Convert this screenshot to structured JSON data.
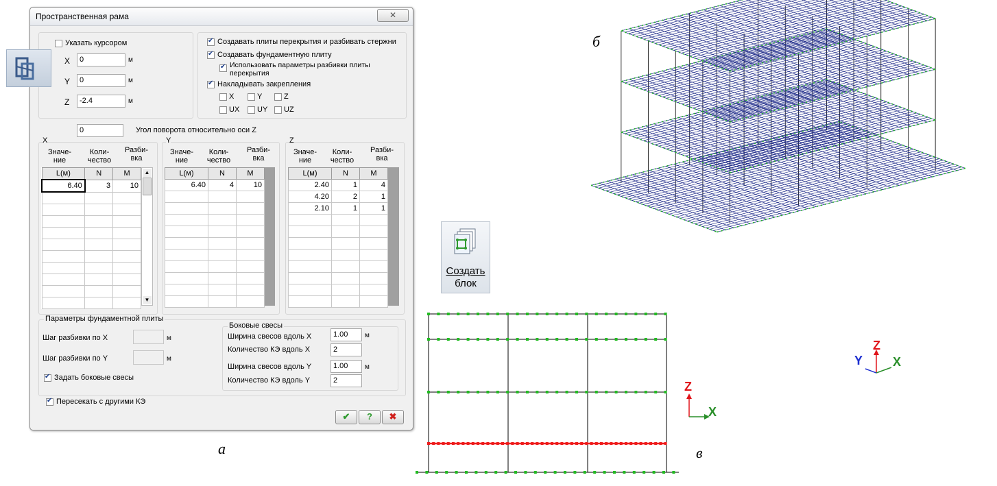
{
  "dialog": {
    "title": "Пространственная рама",
    "close_icon": "close-icon",
    "cursor": {
      "label": "Указать курсором",
      "checked": false
    },
    "coords": [
      {
        "axis": "X",
        "value": "0",
        "unit": "м"
      },
      {
        "axis": "Y",
        "value": "0",
        "unit": "м"
      },
      {
        "axis": "Z",
        "value": "-2.4",
        "unit": "м"
      }
    ],
    "options": {
      "create_slabs": {
        "label": "Создавать плиты перекрытия и разбивать стержни",
        "checked": true
      },
      "create_foundation": {
        "label": "Создавать фундаментную плиту",
        "checked": true
      },
      "use_params": {
        "label": "Использовать параметры разбивки плиты",
        "label2": "перекрытия",
        "checked": true
      },
      "restraints": {
        "label": "Накладывать закрепления",
        "checked": true
      },
      "dofs": [
        {
          "label": "X",
          "checked": false
        },
        {
          "label": "Y",
          "checked": false
        },
        {
          "label": "Z",
          "checked": false
        },
        {
          "label": "UX",
          "checked": false
        },
        {
          "label": "UY",
          "checked": false
        },
        {
          "label": "UZ",
          "checked": false
        }
      ]
    },
    "rotation": {
      "value": "0",
      "label": "Угол поворота относительно оси Z"
    },
    "col_labels": [
      "Значе-",
      "ние",
      "Коли-",
      "чество",
      "Разби-",
      "вка"
    ],
    "grid_headers": [
      "L(м)",
      "N",
      "M"
    ],
    "grids": {
      "x": {
        "title": "X",
        "rows": [
          [
            "6.40",
            "3",
            "10"
          ]
        ]
      },
      "y": {
        "title": "Y",
        "rows": [
          [
            "6.40",
            "4",
            "10"
          ]
        ]
      },
      "z": {
        "title": "Z",
        "rows": [
          [
            "2.40",
            "1",
            "4"
          ],
          [
            "4.20",
            "2",
            "1"
          ],
          [
            "2.10",
            "1",
            "1"
          ]
        ]
      }
    },
    "foundation": {
      "title": "Параметры фундаментной плиты",
      "step_x": {
        "label": "Шаг разбивки по X",
        "value": "",
        "unit": "м"
      },
      "step_y": {
        "label": "Шаг разбивки по Y",
        "value": "",
        "unit": "м"
      },
      "side": {
        "label": "Задать боковые свесы",
        "checked": true
      }
    },
    "overhang": {
      "title": "Боковые свесы",
      "width_x": {
        "label": "Ширина свесов вдоль X",
        "value": "1.00",
        "unit": "м"
      },
      "count_x": {
        "label": "Количество КЭ вдоль X",
        "value": "2"
      },
      "width_y": {
        "label": "Ширина свесов вдоль Y",
        "value": "1.00",
        "unit": "м"
      },
      "count_y": {
        "label": "Количество КЭ вдоль Y",
        "value": "2"
      }
    },
    "intersect": {
      "label": "Пересекать с другими КЭ",
      "checked": true
    },
    "buttons": {
      "ok": "✔",
      "help": "?",
      "cancel": "✖"
    }
  },
  "toolbar_button": {
    "label_line1": "Создать",
    "label_line2": "блок"
  },
  "captions": {
    "a": "а",
    "b": "б",
    "v": "в"
  },
  "axes": {
    "x": "X",
    "y": "Y",
    "z": "Z"
  },
  "colors": {
    "axis_x": "#2a8f2a",
    "axis_y": "#1d2fd0",
    "axis_z": "#e0141a",
    "mesh": "#1f2b8a",
    "node": "#22bb22",
    "foundation": "#ee1c1c"
  }
}
